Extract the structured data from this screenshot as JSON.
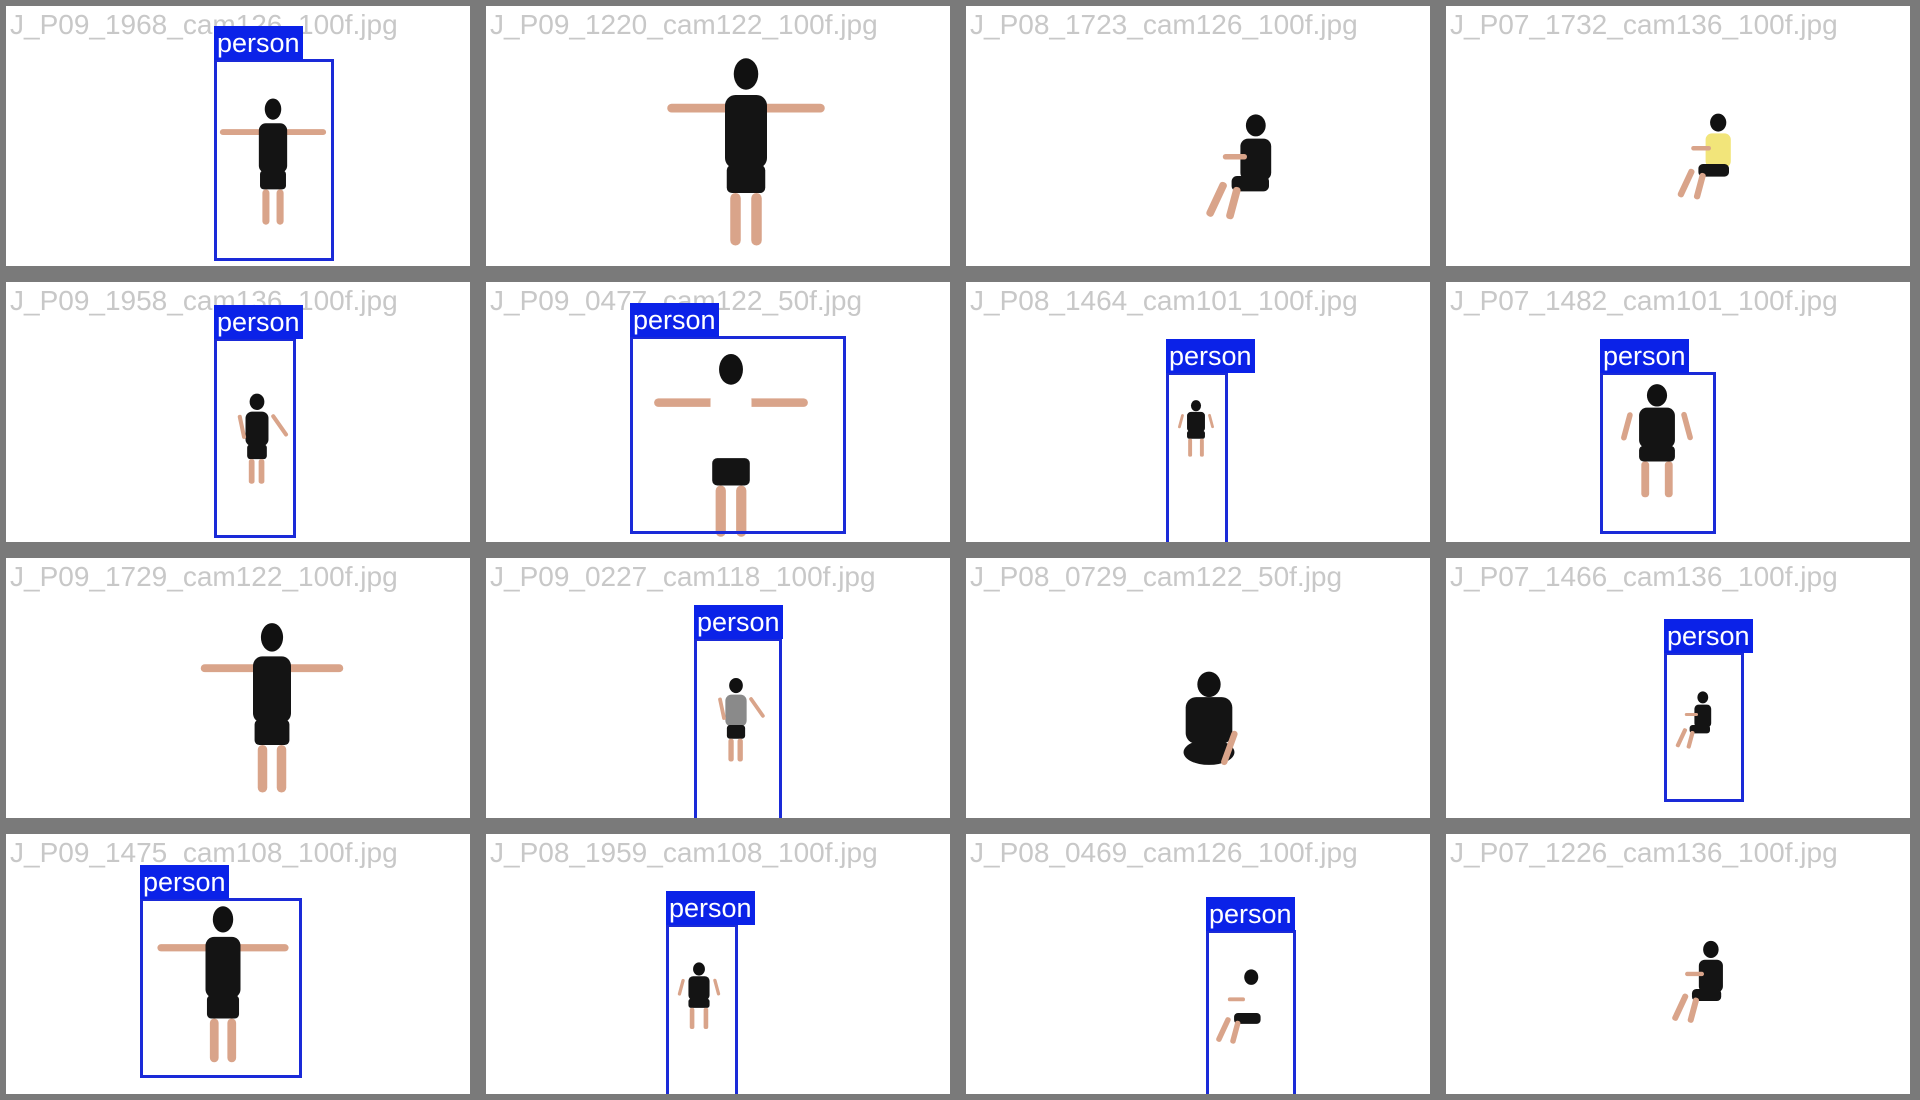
{
  "colors": {
    "background": "#7a7a7a",
    "tile": "#ffffff",
    "filename_text": "#c8c8c8",
    "box": "#1a2ad8",
    "label_bg": "#0b22e8",
    "label_text": "#ffffff"
  },
  "tiles": [
    {
      "filename": "J_P09_1968_cam126_100f.jpg",
      "detected": true,
      "label": "person",
      "pose": "tpose-back",
      "shirt": "#141414"
    },
    {
      "filename": "J_P09_1220_cam122_100f.jpg",
      "detected": false,
      "label": "",
      "pose": "tpose-back",
      "shirt": "#141414"
    },
    {
      "filename": "J_P08_1723_cam126_100f.jpg",
      "detected": false,
      "label": "",
      "pose": "sit-side",
      "shirt": "#141414"
    },
    {
      "filename": "J_P07_1732_cam136_100f.jpg",
      "detected": false,
      "label": "",
      "pose": "sit-side",
      "shirt": "#f2e57a"
    },
    {
      "filename": "J_P09_1958_cam136_100f.jpg",
      "detected": true,
      "label": "person",
      "pose": "stand-side",
      "shirt": "#141414"
    },
    {
      "filename": "J_P09_0477_cam122_50f.jpg",
      "detected": true,
      "label": "person",
      "pose": "tpose-back",
      "shirt": "#ffffff"
    },
    {
      "filename": "J_P08_1464_cam101_100f.jpg",
      "detected": true,
      "label": "person",
      "pose": "sit-front",
      "shirt": "#141414"
    },
    {
      "filename": "J_P07_1482_cam101_100f.jpg",
      "detected": true,
      "label": "person",
      "pose": "sit-front",
      "shirt": "#141414"
    },
    {
      "filename": "J_P09_1729_cam122_100f.jpg",
      "detected": false,
      "label": "",
      "pose": "tpose-back",
      "shirt": "#141414"
    },
    {
      "filename": "J_P09_0227_cam118_100f.jpg",
      "detected": true,
      "label": "person",
      "pose": "stand-side",
      "shirt": "#8a8a8a"
    },
    {
      "filename": "J_P08_0729_cam122_50f.jpg",
      "detected": false,
      "label": "",
      "pose": "sit-back",
      "shirt": "#141414"
    },
    {
      "filename": "J_P07_1466_cam136_100f.jpg",
      "detected": true,
      "label": "person",
      "pose": "sit-side",
      "shirt": "#141414"
    },
    {
      "filename": "J_P09_1475_cam108_100f.jpg",
      "detected": true,
      "label": "person",
      "pose": "tpose-front",
      "shirt": "#141414"
    },
    {
      "filename": "J_P08_1959_cam108_100f.jpg",
      "detected": true,
      "label": "person",
      "pose": "sit-front",
      "shirt": "#141414"
    },
    {
      "filename": "J_P08_0469_cam126_100f.jpg",
      "detected": true,
      "label": "person",
      "pose": "sit-side",
      "shirt": "#ffffff"
    },
    {
      "filename": "J_P07_1226_cam136_100f.jpg",
      "detected": false,
      "label": "",
      "pose": "sit-side",
      "shirt": "#141414"
    }
  ]
}
